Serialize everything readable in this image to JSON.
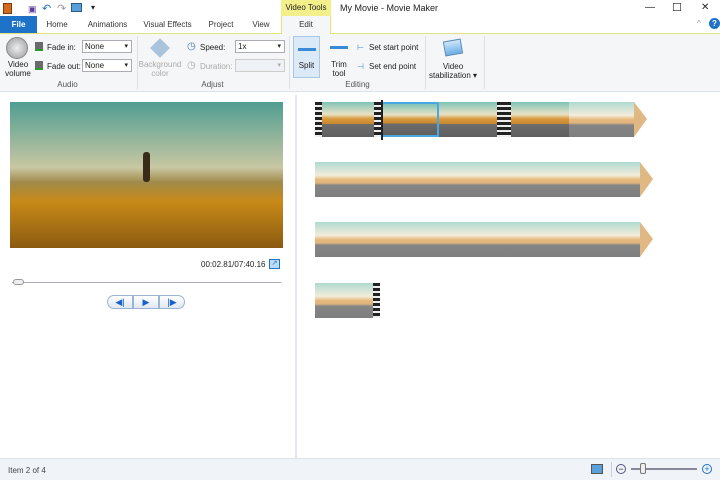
{
  "window": {
    "title": "My Movie - Movie Maker",
    "min": "—",
    "max": "☐",
    "close": "✕",
    "collapse": "^",
    "help": "?"
  },
  "qat": [
    "app-icon",
    "save-icon",
    "undo-icon",
    "redo-icon",
    "screen-icon",
    "customize-icon"
  ],
  "tabs": {
    "file": "File",
    "home": "Home",
    "animations": "Animations",
    "visual_effects": "Visual Effects",
    "project": "Project",
    "view": "View",
    "context": "Video Tools",
    "edit": "Edit"
  },
  "ribbon": {
    "audio": {
      "group": "Audio",
      "video_volume": "Video volume",
      "fade_in_label": "Fade in:",
      "fade_in": "None",
      "fade_out_label": "Fade out:",
      "fade_out": "None"
    },
    "adjust": {
      "group": "Adjust",
      "background_color": "Background color",
      "speed_label": "Speed:",
      "speed": "1x",
      "duration_label": "Duration:",
      "duration": ""
    },
    "editing": {
      "group": "Editing",
      "split": "Split",
      "trim_tool": "Trim tool",
      "set_start": "Set start point",
      "set_end": "Set end point"
    },
    "stabilization": {
      "label": "Video stabilization"
    }
  },
  "preview": {
    "timecode": "00:02.81/07:40.16",
    "progress": 0.006
  },
  "status": {
    "text": "Item 2 of 4",
    "zoom_level": 0.15
  },
  "colors": {
    "accent": "#1e73c8",
    "context_tab": "#f3ef8a",
    "selection": "#4aa8e0"
  }
}
